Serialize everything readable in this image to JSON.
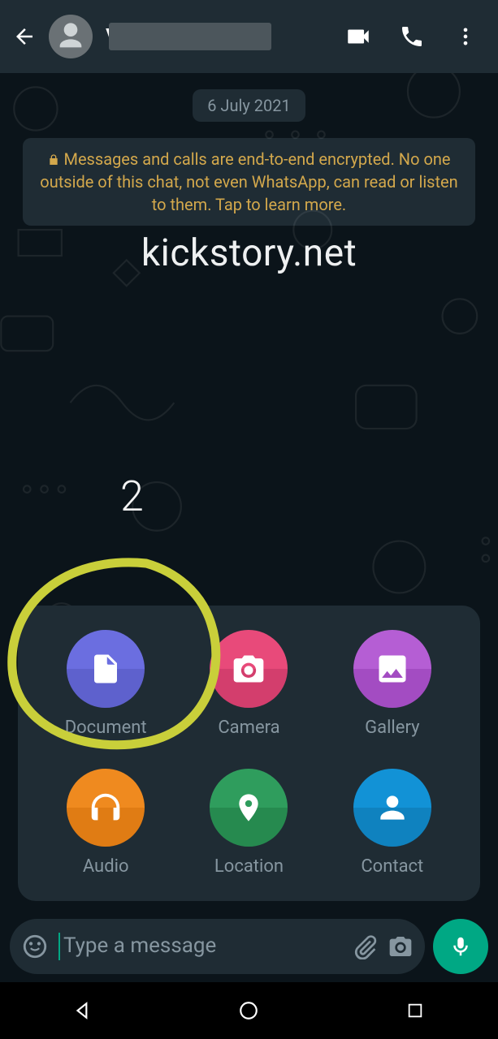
{
  "header": {
    "contact_name": "V",
    "icons": {
      "video": "video-icon",
      "call": "phone-icon",
      "menu": "more-icon"
    }
  },
  "chat": {
    "date_label": "6 July 2021",
    "encryption_notice": "Messages and calls are end-to-end encrypted. No one outside of this chat, not even WhatsApp, can read or listen to them. Tap to learn more.",
    "watermark": "kickstory.net"
  },
  "annotation": {
    "number": "2"
  },
  "attachments": {
    "document": "Document",
    "camera": "Camera",
    "gallery": "Gallery",
    "audio": "Audio",
    "location": "Location",
    "contact": "Contact"
  },
  "composer": {
    "placeholder": "Type a message"
  }
}
